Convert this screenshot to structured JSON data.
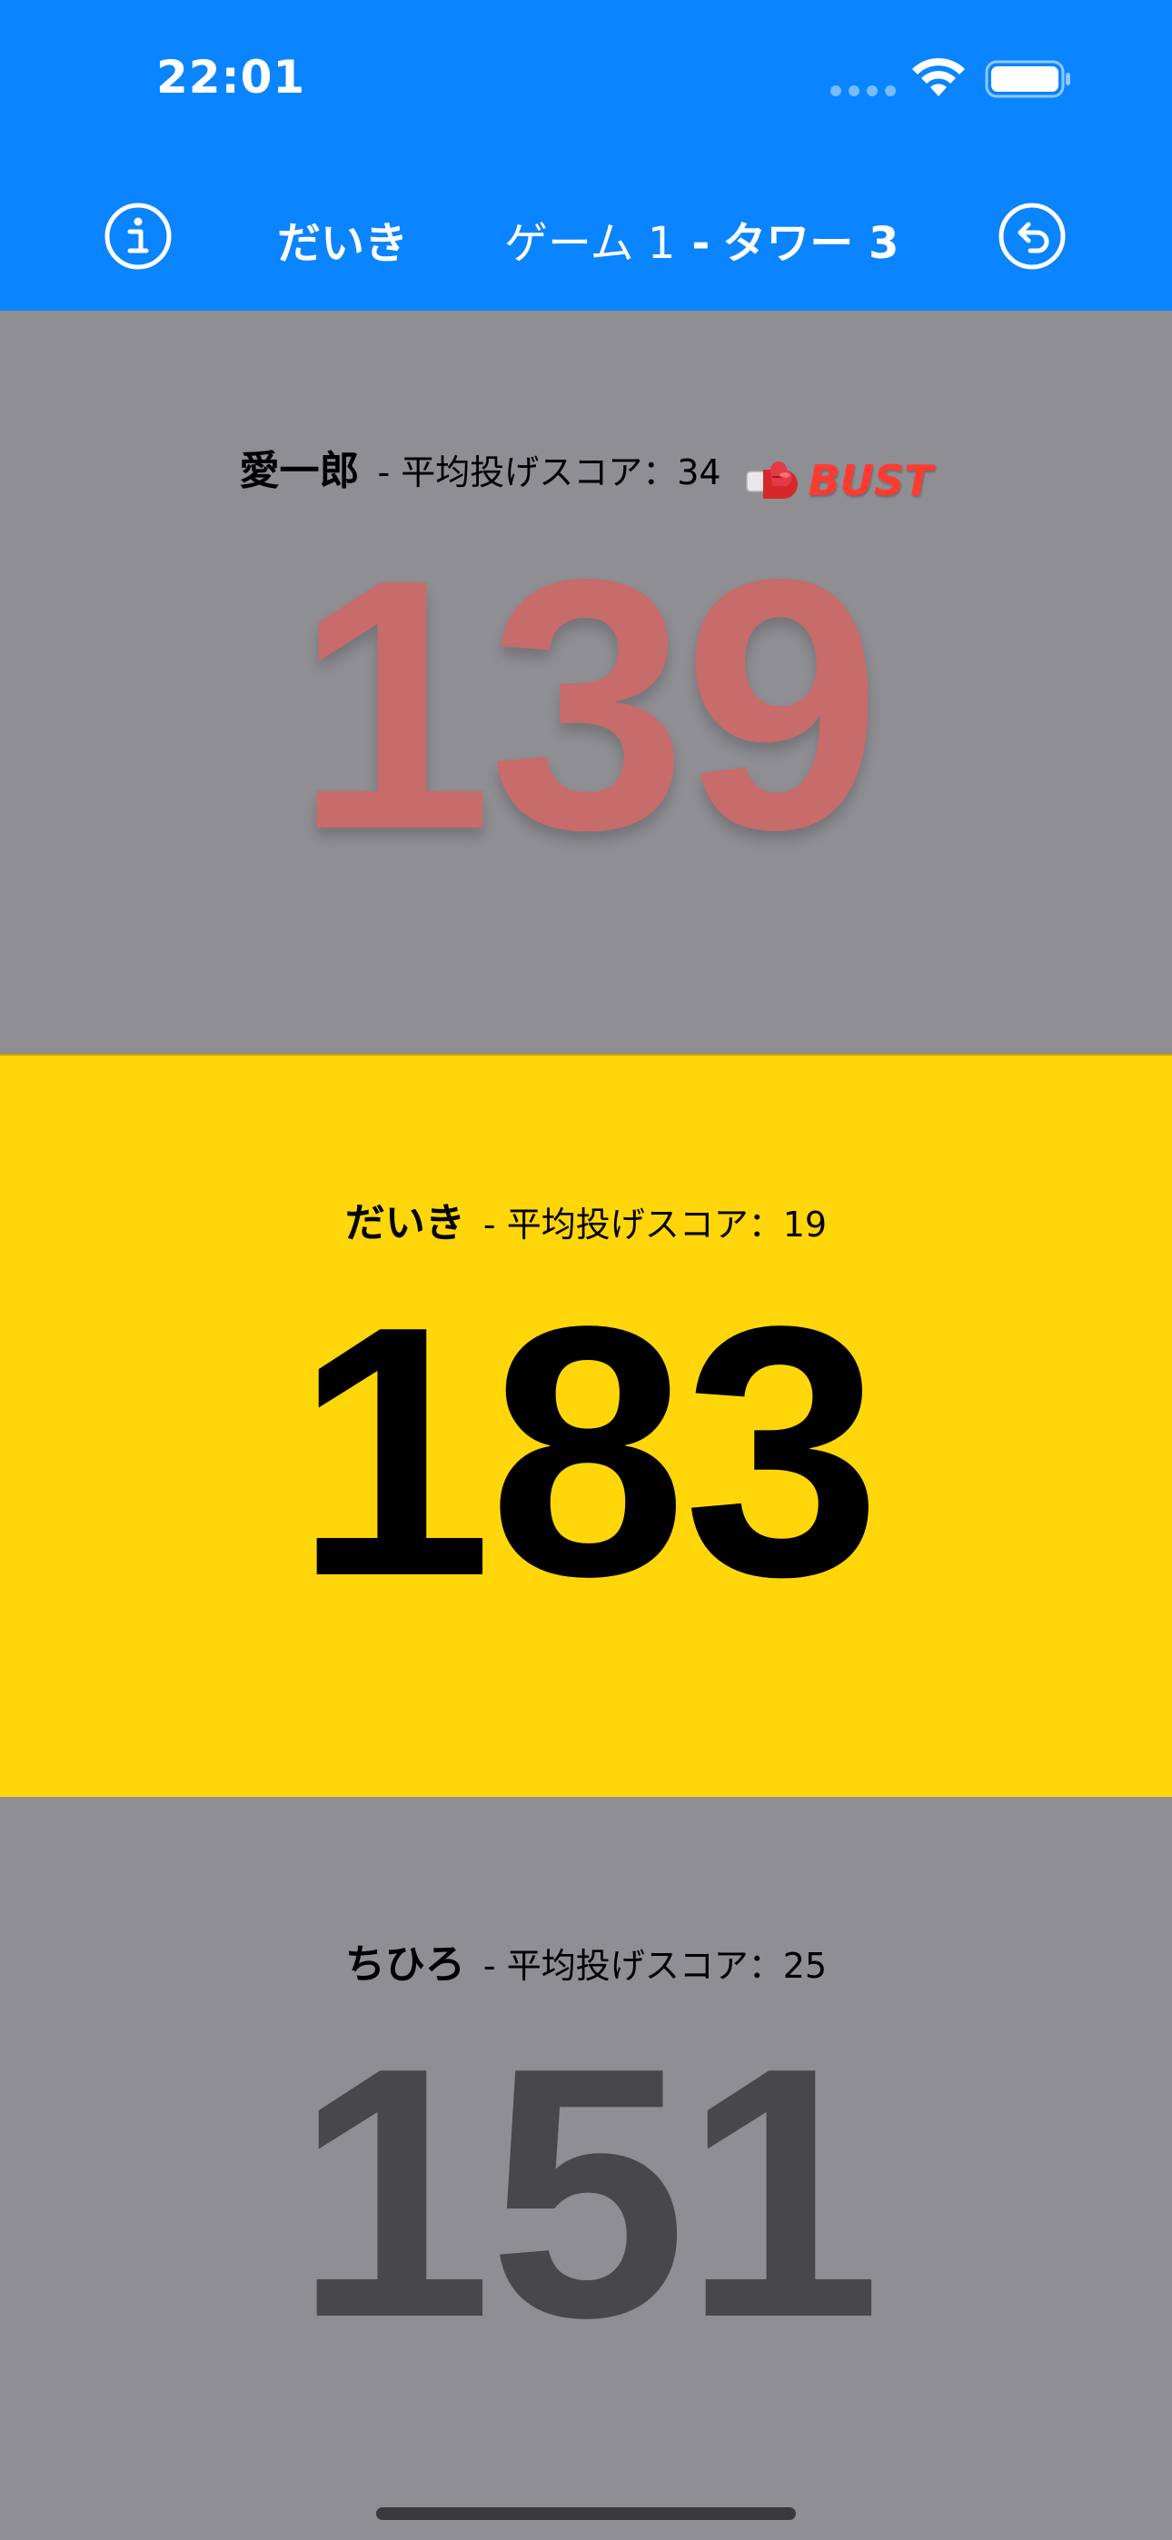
{
  "status_bar": {
    "time": "22:01"
  },
  "header": {
    "current_player": "だいき",
    "game_label": "ゲーム 1",
    "separator": "-",
    "tower_label": "タワー 3",
    "info_icon": "info-circle-icon",
    "undo_icon": "undo-arrow-circle-icon"
  },
  "players": [
    {
      "name": "愛一郎",
      "avg_label": "- 平均投げスコア：34",
      "score": "139",
      "bust_label": "BUST",
      "bust_icon": "boxing-glove-icon"
    },
    {
      "name": "だいき",
      "avg_label": "- 平均投げスコア：19",
      "score": "183"
    },
    {
      "name": "ちひろ",
      "avg_label": "- 平均投げスコア：25",
      "score": "151"
    }
  ],
  "colors": {
    "header_bg": "#0a84ff",
    "active_panel": "#ffd60a",
    "inactive_panel": "#8e8e93",
    "bust_score": "#c76b6b",
    "bust_text": "#ff3b30"
  }
}
